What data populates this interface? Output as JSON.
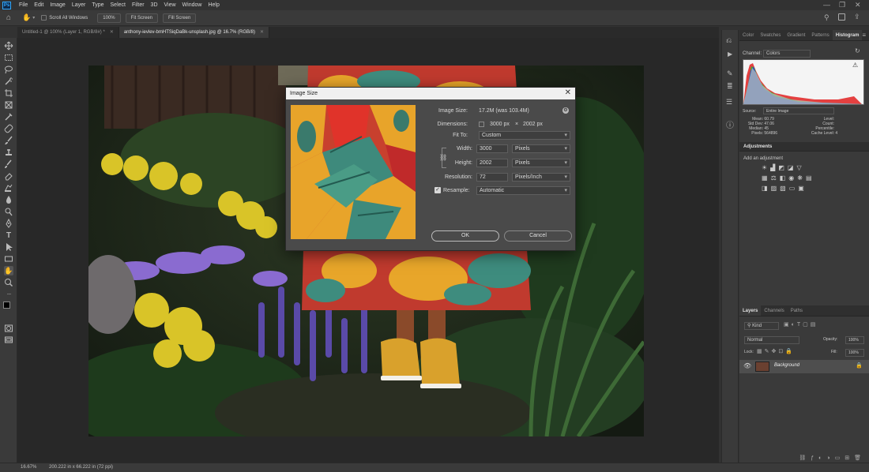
{
  "app": {
    "logo": "Ps"
  },
  "menu": [
    "File",
    "Edit",
    "Image",
    "Layer",
    "Type",
    "Select",
    "Filter",
    "3D",
    "View",
    "Window",
    "Help"
  ],
  "options_bar": {
    "scroll_all_windows": "Scroll All Windows",
    "zoom_btn": "100%",
    "fit_btn": "Fit Screen",
    "fill_btn": "Fill Screen"
  },
  "tabs": [
    {
      "label": "Untitled-1 @ 100% (Layer 1, RGB/8#) *"
    },
    {
      "label": "anthony-ievlev-bmHTSiqDaBk-unsplash.jpg @ 16.7% (RGB/8)"
    }
  ],
  "status": {
    "zoom": "16.67%",
    "doc_size": "200.222 in x 66.222 in (72 ppi)"
  },
  "right_panel": {
    "top_tabs": [
      "Color",
      "Swatches",
      "Gradient",
      "Patterns",
      "Histogram"
    ],
    "channel_label": "Channel:",
    "channel_value": "Colors",
    "source_label": "Source:",
    "source_value": "Entire Image",
    "stats_left": [
      [
        "Mean:",
        "60.79"
      ],
      [
        "Std Dev:",
        "47.06"
      ],
      [
        "Median:",
        "45"
      ],
      [
        "Pixels:",
        "564896"
      ]
    ],
    "stats_right": [
      [
        "Level:",
        ""
      ],
      [
        "Count:",
        ""
      ],
      [
        "Percentile:",
        ""
      ],
      [
        "Cache Level:",
        "4"
      ]
    ],
    "adjustments_title": "Adjustments",
    "adjustments_hint": "Add an adjustment",
    "layer_tabs": [
      "Layers",
      "Channels",
      "Paths"
    ],
    "layer_kind": "Kind",
    "blend_mode": "Normal",
    "opacity_label": "Opacity:",
    "opacity_value": "100%",
    "lock_label": "Lock:",
    "fill_label": "Fill:",
    "fill_value": "100%",
    "layer_name": "Background"
  },
  "dialog": {
    "title": "Image Size",
    "close": "✕",
    "image_size_label": "Image Size:",
    "image_size_value": "17.2M (was 103.4M)",
    "dimensions_label": "Dimensions:",
    "dimensions_w": "3000 px",
    "dimensions_x": "×",
    "dimensions_h": "2002 px",
    "fit_to_label": "Fit To:",
    "fit_to_value": "Custom",
    "width_label": "Width:",
    "width_value": "3000",
    "width_unit": "Pixels",
    "height_label": "Height:",
    "height_value": "2002",
    "height_unit": "Pixels",
    "resolution_label": "Resolution:",
    "resolution_value": "72",
    "resolution_unit": "Pixels/Inch",
    "resample_label": "Resample:",
    "resample_value": "Automatic",
    "ok": "OK",
    "cancel": "Cancel"
  },
  "colors": {
    "accent": "#31a8ff",
    "bg": "#323232",
    "panel": "#3a3a3a"
  }
}
